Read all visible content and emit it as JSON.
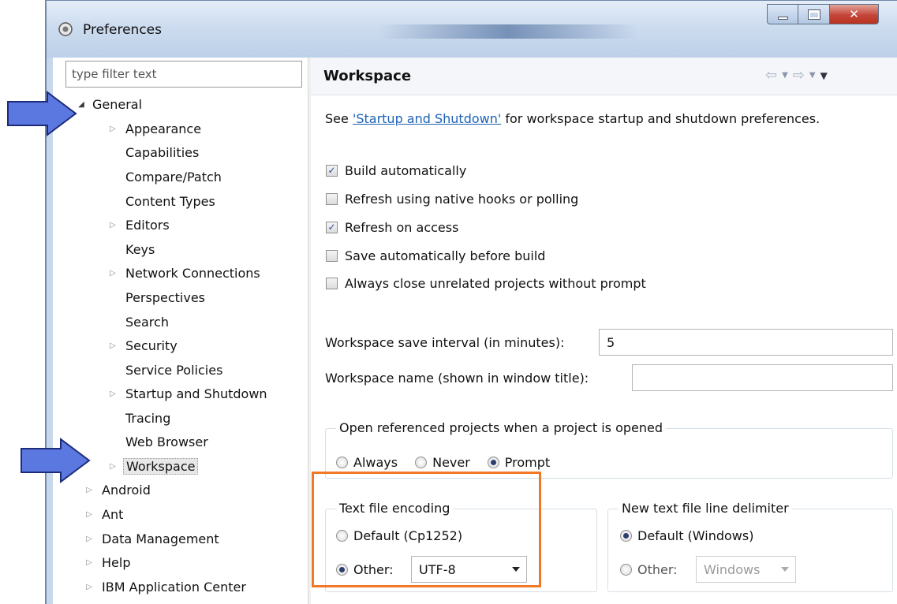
{
  "window": {
    "title": "Preferences"
  },
  "filter": {
    "placeholder": "type filter text"
  },
  "tree": [
    {
      "label": "General",
      "expanded": true
    },
    {
      "label": "Appearance",
      "has_children": true
    },
    {
      "label": "Capabilities"
    },
    {
      "label": "Compare/Patch"
    },
    {
      "label": "Content Types"
    },
    {
      "label": "Editors",
      "has_children": true
    },
    {
      "label": "Keys"
    },
    {
      "label": "Network Connections",
      "has_children": true
    },
    {
      "label": "Perspectives"
    },
    {
      "label": "Search"
    },
    {
      "label": "Security",
      "has_children": true
    },
    {
      "label": "Service Policies"
    },
    {
      "label": "Startup and Shutdown",
      "has_children": true
    },
    {
      "label": "Tracing"
    },
    {
      "label": "Web Browser"
    },
    {
      "label": "Workspace",
      "has_children": true,
      "selected": true
    },
    {
      "label": "Android",
      "has_children": true
    },
    {
      "label": "Ant",
      "has_children": true
    },
    {
      "label": "Data Management",
      "has_children": true
    },
    {
      "label": "Help",
      "has_children": true
    },
    {
      "label": "IBM Application Center",
      "has_children": true
    }
  ],
  "page": {
    "title": "Workspace",
    "intro_prefix": "See ",
    "intro_link": "'Startup and Shutdown'",
    "intro_suffix": " for workspace startup and shutdown preferences.",
    "checkboxes": [
      {
        "label": "Build automatically",
        "checked": true
      },
      {
        "label": "Refresh using native hooks or polling",
        "checked": false
      },
      {
        "label": "Refresh on access",
        "checked": true
      },
      {
        "label": "Save automatically before build",
        "checked": false
      },
      {
        "label": "Always close unrelated projects without prompt",
        "checked": false
      }
    ],
    "save_interval": {
      "label": "Workspace save interval (in minutes):",
      "value": "5"
    },
    "workspace_name": {
      "label": "Workspace name (shown in window title):",
      "value": ""
    },
    "open_referenced": {
      "title": "Open referenced projects when a project is opened",
      "options": [
        {
          "label": "Always",
          "selected": false
        },
        {
          "label": "Never",
          "selected": false
        },
        {
          "label": "Prompt",
          "selected": true
        }
      ]
    },
    "encoding": {
      "title": "Text file encoding",
      "default_label": "Default (Cp1252)",
      "other_label": "Other:",
      "selected": "other",
      "other_value": "UTF-8"
    },
    "line_delimiter": {
      "title": "New text file line delimiter",
      "default_label": "Default (Windows)",
      "other_label": "Other:",
      "selected": "default",
      "other_value": "Windows"
    }
  },
  "colors": {
    "highlight": "#f07826",
    "callout_arrow": "#5b78e0",
    "link": "#1d62b5"
  }
}
